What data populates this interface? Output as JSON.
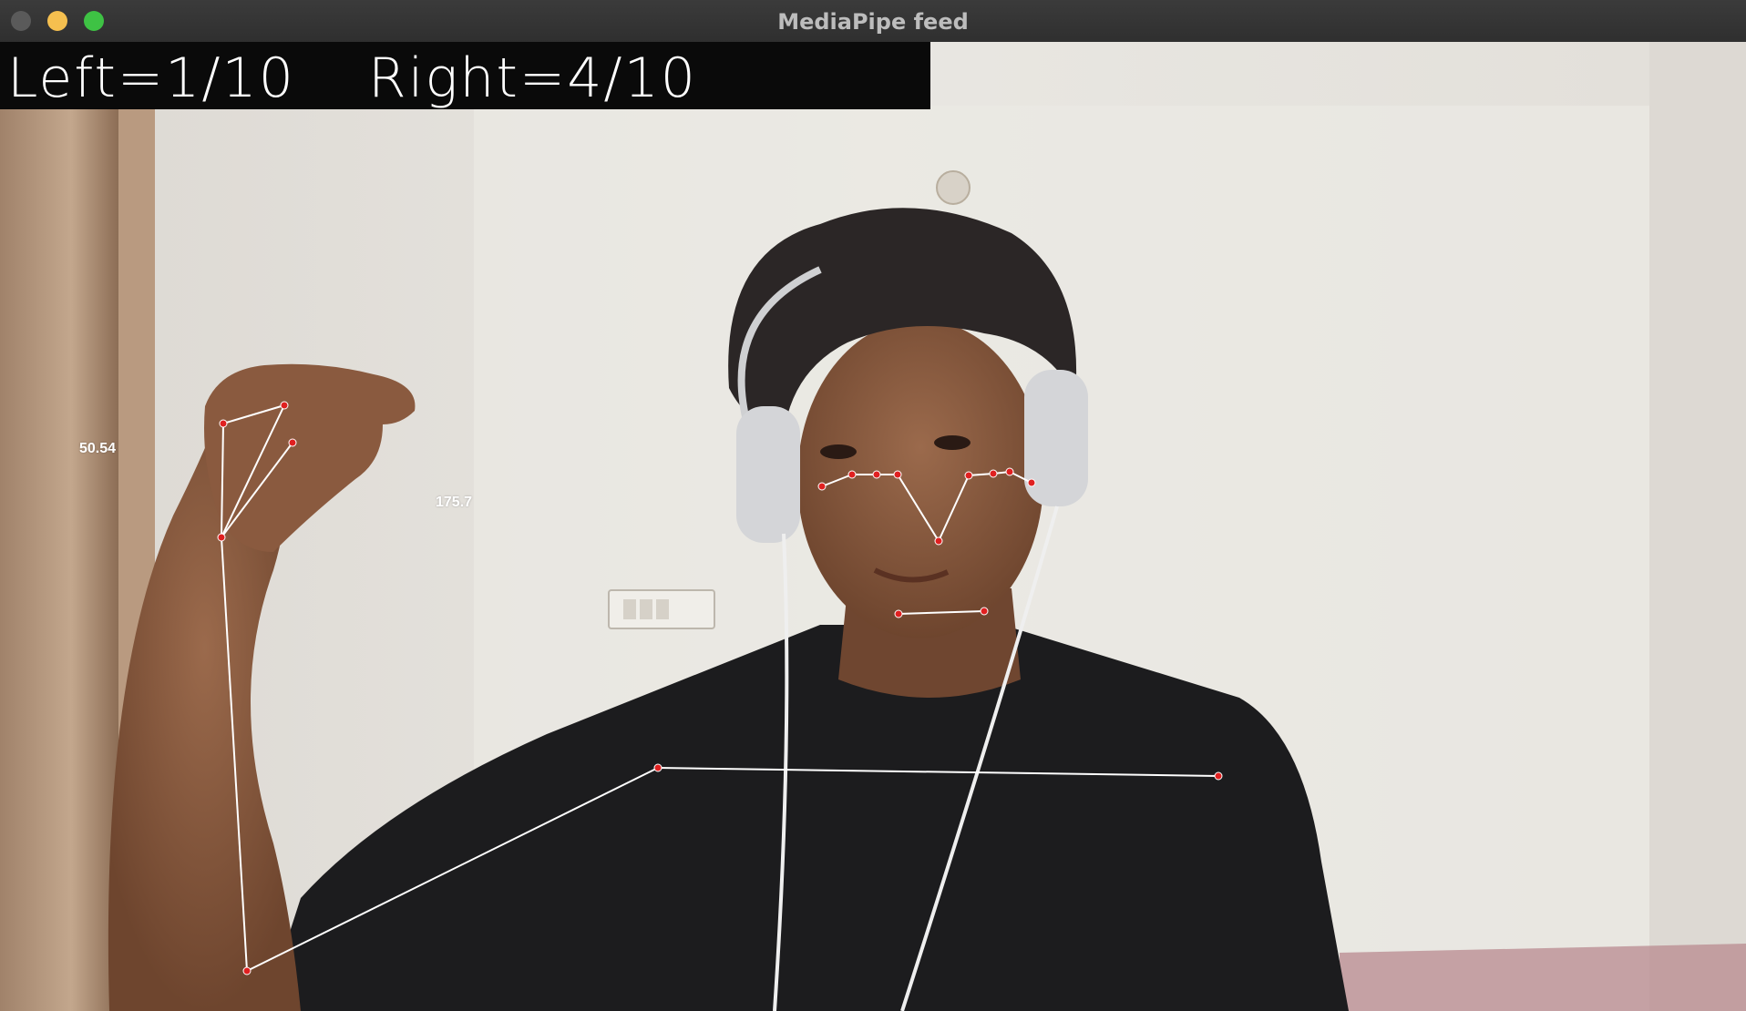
{
  "window": {
    "title": "MediaPipe feed"
  },
  "overlay": {
    "left_counter": "Left=1/10",
    "right_counter": "Right=4/10"
  },
  "angles": {
    "left_elbow": "50.54",
    "shoulder": "175.7"
  },
  "colors": {
    "landmark": "#e02020",
    "connection": "#ffffff",
    "bar": "#0a0a0a",
    "shirt": "#1c1c1e",
    "wall": "#e6e3de"
  }
}
